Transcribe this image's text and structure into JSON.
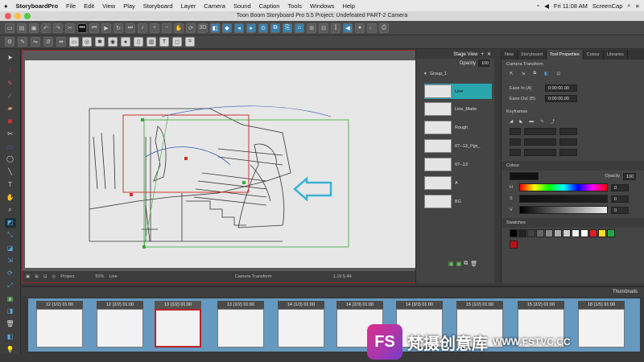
{
  "menubar": {
    "apple": "",
    "app_name": "StoryboardPro",
    "items": [
      "File",
      "Edit",
      "View",
      "Play",
      "Storyboard",
      "Layer",
      "Camera",
      "Sound",
      "Caption",
      "Tools",
      "Windows",
      "Help"
    ],
    "clock": "Fri 11:08 AM",
    "right_app": "ScreenCap"
  },
  "window": {
    "title": "Toon Boom Storyboard Pro 5.5 Project: Undefeated PART-2 Camera"
  },
  "stage_view": {
    "title": "Stage View",
    "opacity_label": "Opacity",
    "opacity_value": "100",
    "bottom": {
      "project_label": "Project",
      "zoom": "50%",
      "tool": "Line",
      "mode": "Camera Transform",
      "position": "1.19.5.44"
    }
  },
  "layers": {
    "group": "Group_1",
    "items": [
      {
        "name": "Line",
        "selected": true
      },
      {
        "name": "Line_Matte",
        "selected": false
      },
      {
        "name": "Rough",
        "selected": false
      },
      {
        "name": "07--13_Pgs_",
        "selected": false
      },
      {
        "name": "07--13",
        "selected": false
      },
      {
        "name": "A",
        "selected": false
      },
      {
        "name": "BG",
        "selected": false
      }
    ]
  },
  "right_panel": {
    "tabs": [
      "New",
      "Storyboard",
      "Tool Properties",
      "Colour",
      "Libraries"
    ],
    "active_tab": "Tool Properties",
    "camera_transform": "Camera Transform",
    "ease_in_label": "Ease In (A)",
    "ease_in_value": "0:00:00.00",
    "ease_out_label": "Ease Out (B)",
    "ease_out_value": "0:00:00.00",
    "keyframes_label": "Keyframes",
    "colour_title": "Colour",
    "opacity_label": "Opacity",
    "opacity_value": "100",
    "h_label": "H",
    "h_value": "0",
    "s_label": "S",
    "s_value": "0",
    "v_label": "V",
    "v_value": "0",
    "swatches_label": "Swatches",
    "current_colour": "#111111"
  },
  "timeline": {
    "title": "Thumbnails",
    "panels": [
      {
        "label": "12 (1/2) 01:00",
        "selected": false
      },
      {
        "label": "12 (2/2) 01:00",
        "selected": false
      },
      {
        "label": "13 (1/2) 01:00",
        "selected": true
      },
      {
        "label": "13 (2/2) 01:00",
        "selected": false
      },
      {
        "label": "14 (1/3) 01:00",
        "selected": false
      },
      {
        "label": "14 (2/3) 01:00",
        "selected": false
      },
      {
        "label": "14 (3/3) 01:00",
        "selected": false
      },
      {
        "label": "15 (1/2) 01:00",
        "selected": false
      },
      {
        "label": "15 (2/2) 01:00",
        "selected": false
      },
      {
        "label": "18 (1/5) 01:00",
        "selected": false
      }
    ]
  },
  "watermark": {
    "logo": "FS",
    "chinese": "梵摄创意库",
    "url": "WWW.FSTVC.CC"
  },
  "colors": {
    "selected_layer": "#2aa6ad",
    "timeline_bg": "#6699bf",
    "selected_panel_border": "#bb2222"
  }
}
